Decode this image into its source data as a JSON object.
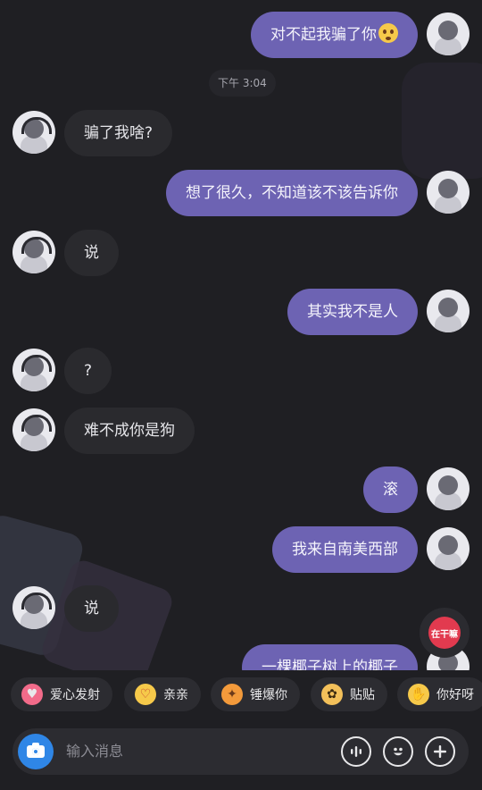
{
  "timestamp": "下午 3:04",
  "messages": [
    {
      "side": "out",
      "text": "对不起我骗了你",
      "emoji": "flushed-face"
    },
    {
      "side": "in",
      "text": "骗了我啥?"
    },
    {
      "side": "out",
      "text": "想了很久，不知道该不该告诉你"
    },
    {
      "side": "in",
      "text": "说"
    },
    {
      "side": "out",
      "text": "其实我不是人"
    },
    {
      "side": "in",
      "text": "?"
    },
    {
      "side": "in",
      "text": "难不成你是狗"
    },
    {
      "side": "out",
      "text": "滚"
    },
    {
      "side": "out",
      "text": "我来自南美西部"
    },
    {
      "side": "in",
      "text": "说"
    },
    {
      "side": "out",
      "text": "一棵椰子树上的椰子"
    }
  ],
  "fab": {
    "label": "在干嘛",
    "icon": "mascot-icon"
  },
  "quick_replies": [
    {
      "label": "爱心发射",
      "icon": "heart-eyes-emoji-icon",
      "color": "#f26b8a"
    },
    {
      "label": "亲亲",
      "icon": "kiss-emoji-icon",
      "color": "#f6c94a"
    },
    {
      "label": "锤爆你",
      "icon": "hammer-emoji-icon",
      "color": "#f39a3b"
    },
    {
      "label": "贴贴",
      "icon": "hug-cats-emoji-icon",
      "color": "#f3c05a"
    },
    {
      "label": "你好呀",
      "icon": "wave-emoji-icon",
      "color": "#f6c94a"
    }
  ],
  "input": {
    "placeholder": "输入消息"
  },
  "colors": {
    "background": "#1f1f23",
    "outgoing_bubble": "#6d63b3",
    "incoming_bubble": "#2a2a2e",
    "camera": "#2f86e6"
  }
}
